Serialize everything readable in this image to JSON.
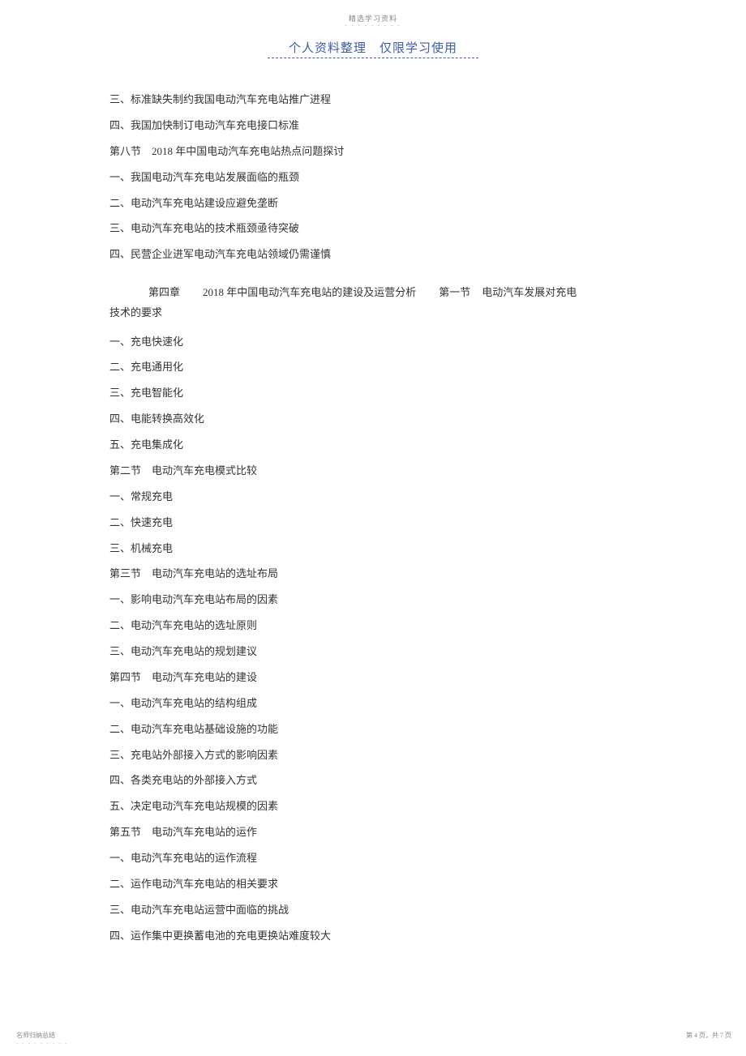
{
  "header": {
    "top_label": "精选学习资料",
    "title": "个人资料整理　仅限学习使用"
  },
  "content": {
    "lines_before": [
      "三、标准缺失制约我国电动汽车充电站推广进程",
      "四、我国加快制订电动汽车充电接口标准",
      "第八节　2018 年中国电动汽车充电站热点问题探讨",
      "一、我国电动汽车充电站发展面临的瓶颈",
      "二、电动汽车充电站建设应避免垄断",
      "三、电动汽车充电站的技术瓶颈亟待突破",
      "四、民营企业进军电动汽车充电站领域仍需谨慎"
    ],
    "chapter_row": {
      "chapter": "第四章",
      "chapter_title": "2018 年中国电动汽车充电站的建设及运营分析",
      "section": "第一节",
      "section_title_part1": "电动汽车发展对充电",
      "section_title_part2": "技术的要求"
    },
    "lines_after": [
      "一、充电快速化",
      "二、充电通用化",
      "三、充电智能化",
      "四、电能转换高效化",
      "五、充电集成化",
      "第二节　电动汽车充电模式比较",
      "一、常规充电",
      "二、快速充电",
      "三、机械充电",
      "第三节　电动汽车充电站的选址布局",
      "一、影响电动汽车充电站布局的因素",
      "二、电动汽车充电站的选址原则",
      "三、电动汽车充电站的规划建议",
      "第四节　电动汽车充电站的建设",
      "一、电动汽车充电站的结构组成",
      "二、电动汽车充电站基础设施的功能",
      "三、充电站外部接入方式的影响因素",
      "四、各类充电站的外部接入方式",
      "五、决定电动汽车充电站规模的因素",
      "第五节　电动汽车充电站的运作",
      "一、电动汽车充电站的运作流程",
      "二、运作电动汽车充电站的相关要求",
      "三、电动汽车充电站运营中面临的挑战",
      "四、运作集中更换蓄电池的充电更换站难度较大"
    ]
  },
  "footer": {
    "left": "名师归纳总结",
    "right": "第 4 页，共 7 页"
  }
}
